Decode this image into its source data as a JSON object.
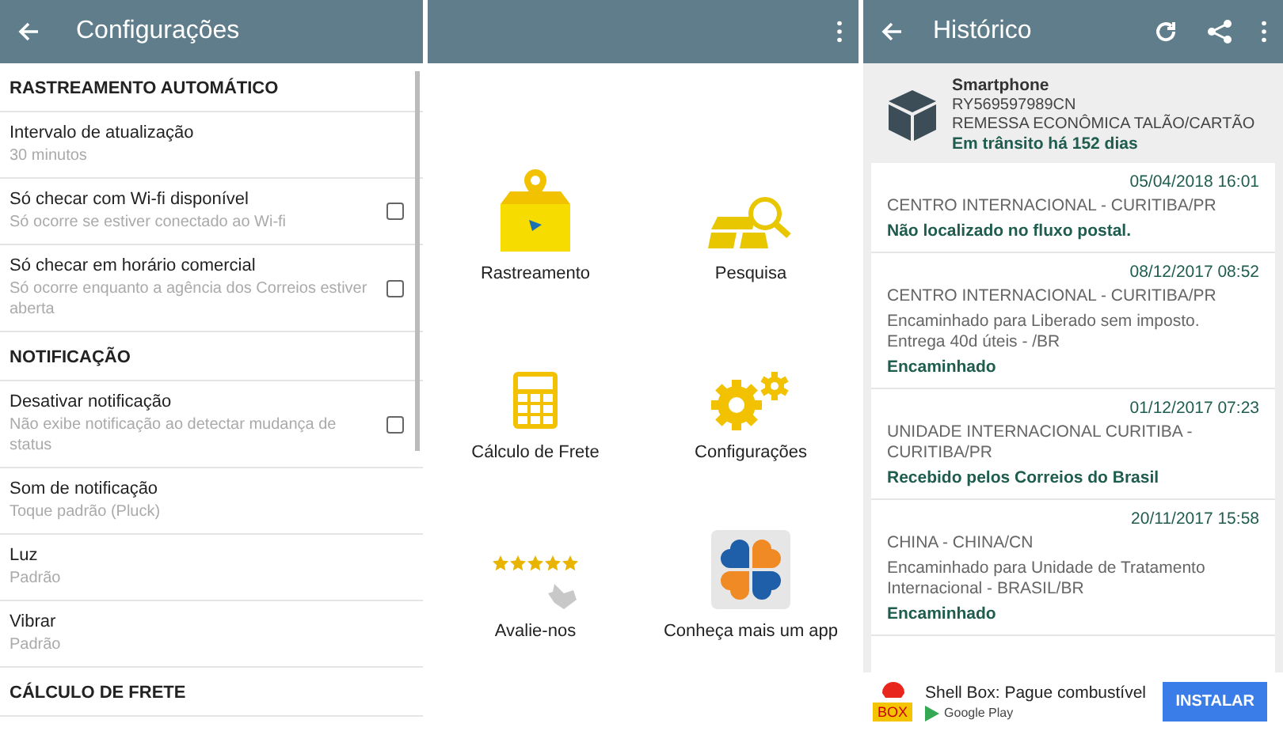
{
  "settings_screen": {
    "title": "Configurações",
    "items": [
      {
        "kind": "section",
        "title": "RASTREAMENTO AUTOMÁTICO"
      },
      {
        "kind": "setting",
        "title": "Intervalo de atualização",
        "summary": "30 minutos"
      },
      {
        "kind": "checkbox",
        "title": "Só checar com Wi-fi disponível",
        "summary": "Só ocorre se estiver conectado ao Wi-fi",
        "checked": false
      },
      {
        "kind": "checkbox",
        "title": "Só checar em horário comercial",
        "summary": "Só ocorre enquanto a agência dos Correios estiver aberta",
        "checked": false
      },
      {
        "kind": "section",
        "title": "NOTIFICAÇÃO"
      },
      {
        "kind": "checkbox",
        "title": "Desativar notificação",
        "summary": "Não exibe notificação ao detectar mudança de status",
        "checked": false
      },
      {
        "kind": "setting",
        "title": "Som de notificação",
        "summary": "Toque padrão (Pluck)"
      },
      {
        "kind": "setting",
        "title": "Luz",
        "summary": "Padrão"
      },
      {
        "kind": "setting",
        "title": "Vibrar",
        "summary": "Padrão"
      },
      {
        "kind": "section",
        "title": "CÁLCULO DE FRETE"
      }
    ]
  },
  "home_screen": {
    "menu": [
      {
        "kind": "tracking",
        "label": "Rastreamento"
      },
      {
        "kind": "search",
        "label": "Pesquisa"
      },
      {
        "kind": "calculator",
        "label": "Cálculo de Frete"
      },
      {
        "kind": "settings",
        "label": "Configurações"
      },
      {
        "kind": "rate",
        "label": "Avalie-nos"
      },
      {
        "kind": "app",
        "label": "Conheça mais um app"
      }
    ]
  },
  "history_screen": {
    "title": "Histórico",
    "package": {
      "name": "Smartphone",
      "code": "RY569597989CN",
      "service": "REMESSA ECONÔMICA TALÃO/CARTÃO",
      "status": "Em trânsito há 152 dias"
    },
    "events": [
      {
        "datetime": "05/04/2018 16:01",
        "place": "CENTRO INTERNACIONAL - CURITIBA/PR",
        "status": "Não localizado no fluxo postal."
      },
      {
        "datetime": "08/12/2017 08:52",
        "place": "CENTRO INTERNACIONAL - CURITIBA/PR",
        "detail": "Encaminhado para Liberado sem imposto. Entrega 40d úteis - /BR",
        "status": "Encaminhado"
      },
      {
        "datetime": "01/12/2017 07:23",
        "place": "UNIDADE INTERNACIONAL CURITIBA - CURITIBA/PR",
        "status": "Recebido pelos Correios do Brasil"
      },
      {
        "datetime": "20/11/2017 15:58",
        "place": "CHINA - CHINA/CN",
        "detail": "Encaminhado para Unidade de Tratamento Internacional - BRASIL/BR",
        "status": "Encaminhado"
      }
    ],
    "ad": {
      "badge": "BOX",
      "title": "Shell Box: Pague combustível",
      "store": "Google Play",
      "button": "INSTALAR"
    }
  }
}
